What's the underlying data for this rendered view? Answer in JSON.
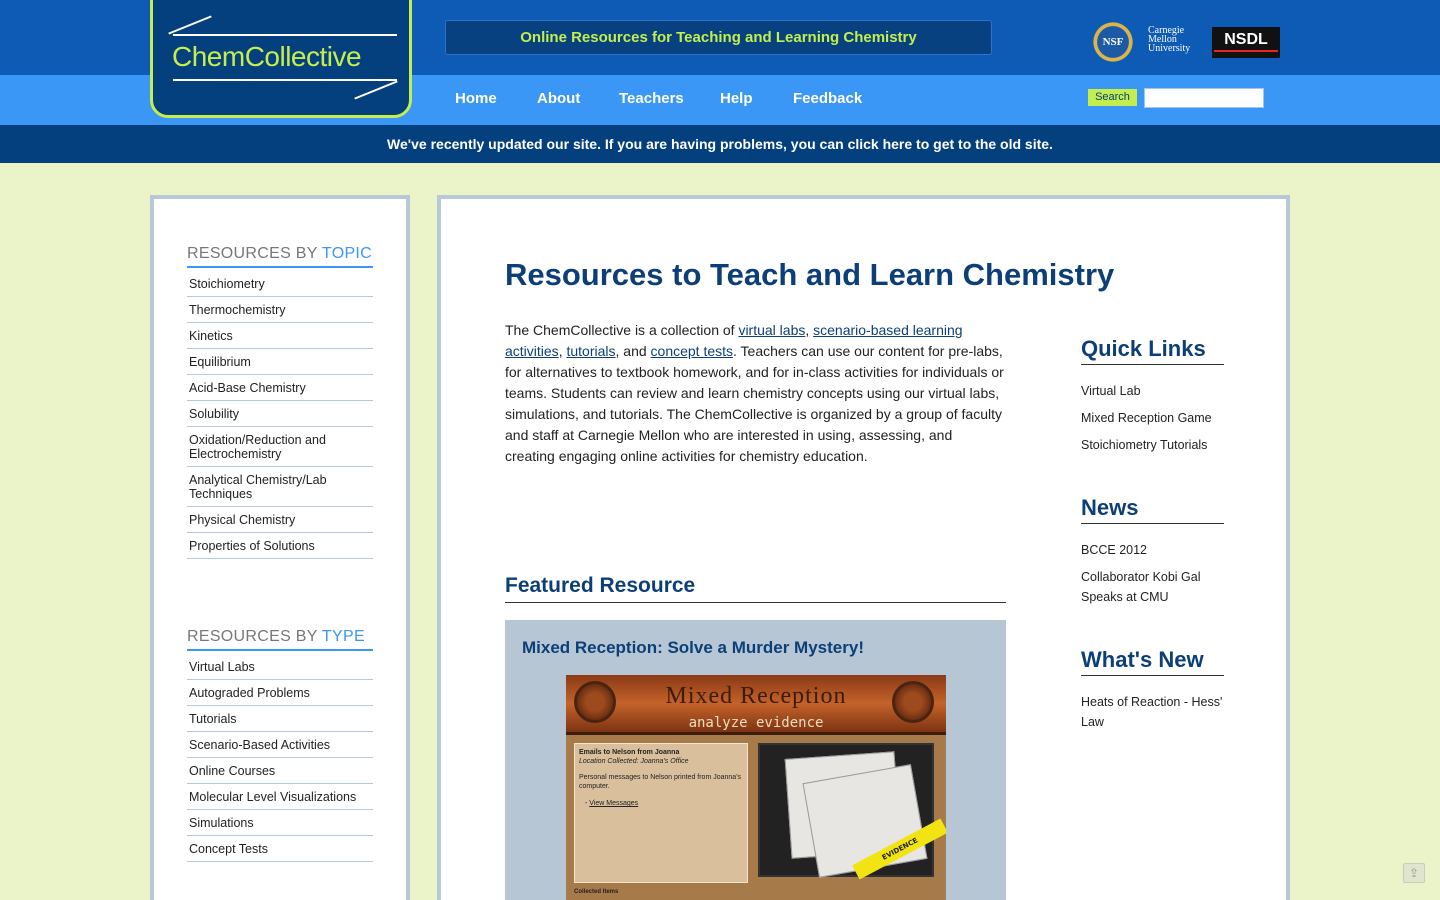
{
  "header": {
    "logo_text": "ChemCollective",
    "tagline": "Online Resources for Teaching and Learning Chemistry",
    "partner_logos": {
      "nsf": "NSF",
      "cmu": "Carnegie Mellon University",
      "nsdl": "NSDL"
    },
    "nav": [
      "Home",
      "About",
      "Teachers",
      "Help",
      "Feedback"
    ],
    "search_label": "Search",
    "search_value": "",
    "notice": "We've recently updated our site. If you are having problems, you can click here to get to the old site.",
    "accent_color": "#c4ee4e",
    "brand_color": "#0d5bb5"
  },
  "sidebar": {
    "topic_heading_plain": "RESOURCES BY ",
    "topic_heading_accent": "TOPIC",
    "topics": [
      "Stoichiometry",
      "Thermochemistry",
      "Kinetics",
      "Equilibrium",
      "Acid-Base Chemistry",
      "Solubility",
      "Oxidation/Reduction and Electrochemistry",
      "Analytical Chemistry/Lab Techniques",
      "Physical Chemistry",
      "Properties of Solutions"
    ],
    "type_heading_plain": "RESOURCES BY ",
    "type_heading_accent": "TYPE",
    "types": [
      "Virtual Labs",
      "Autograded Problems",
      "Tutorials",
      "Scenario-Based Activities",
      "Online Courses",
      "Molecular Level Visualizations",
      "Simulations",
      "Concept Tests"
    ]
  },
  "main": {
    "title": "Resources to Teach and Learn Chemistry",
    "intro": {
      "t1": "The ChemCollective is a collection of ",
      "link_virtual_labs": "virtual labs",
      "t2": ", ",
      "link_scenario": "scenario-based learning activities",
      "t3": ", ",
      "link_tutorials": "tutorials",
      "t4": ", and ",
      "link_concept": "concept tests",
      "t5": ". Teachers can use our content for pre-labs, for alternatives to textbook homework, and for in-class activities for individuals or teams. Students can review and learn chemistry concepts using our virtual labs, simulations, and tutorials. The ChemCollective is organized by a group of faculty and staff at Carnegie Mellon who are interested in using, assessing, and creating engaging online activities for chemistry education."
    },
    "featured_heading": "Featured Resource",
    "featured_title": "Mixed Reception: Solve a Murder Mystery!",
    "game": {
      "banner_title": "Mixed Reception",
      "banner_sub": "analyze evidence",
      "panel_title": "Emails to Nelson from Joanna",
      "panel_location": "Location Collected:  Joanna's Office",
      "panel_desc": "Personal messages to Nelson printed from Joanna's computer.",
      "panel_link": "View Messages",
      "tape_text": "EVIDENCE",
      "collected": "Collected Items"
    }
  },
  "right": {
    "quick_links_heading": "Quick Links",
    "quick_links": [
      "Virtual Lab",
      "Mixed Reception Game",
      "Stoichiometry Tutorials"
    ],
    "news_heading": "News",
    "news": [
      "BCCE 2012",
      "Collaborator Kobi Gal Speaks at CMU"
    ],
    "whats_new_heading": "What's New",
    "whats_new": [
      "Heats of Reaction - Hess' Law"
    ]
  },
  "icons": {
    "share": "share-icon"
  }
}
